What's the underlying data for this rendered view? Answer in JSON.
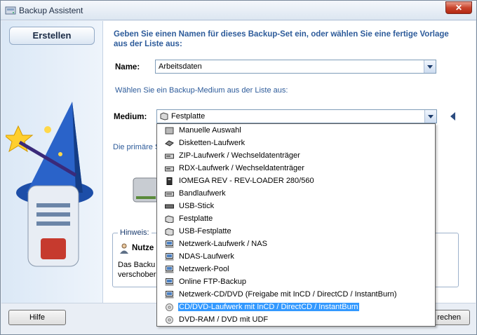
{
  "window": {
    "title": "Backup Assistent",
    "close_glyph": "✕"
  },
  "left": {
    "tab_label": "Erstellen"
  },
  "instruction": "Geben Sie einen Namen für dieses Backup-Set ein, oder wählen Sie eine fertige Vorlage aus der Liste aus:",
  "name_field": {
    "label": "Name:",
    "value": "Arbeitsdaten"
  },
  "medium_instruction": "Wählen Sie ein Backup-Medium aus der Liste aus:",
  "medium_field": {
    "label": "Medium:",
    "value": "Festplatte"
  },
  "partial_text": "Die primäre S",
  "hint": {
    "title": "Hinweis:",
    "head": "Nutze",
    "line1": "Das Backu",
    "line2": "verschober"
  },
  "buttons": {
    "help": "Hilfe",
    "cancel_partial": "rechen"
  },
  "medium_options": [
    {
      "label": "Manuelle Auswahl",
      "icon": "manual-icon"
    },
    {
      "label": "Disketten-Laufwerk",
      "icon": "floppy-icon"
    },
    {
      "label": "ZIP-Laufwerk / Wechseldatenträger",
      "icon": "zip-drive-icon"
    },
    {
      "label": "RDX-Laufwerk / Wechseldatenträger",
      "icon": "rdx-drive-icon"
    },
    {
      "label": "IOMEGA REV - REV-LOADER 280/560",
      "icon": "rev-drive-icon"
    },
    {
      "label": "Bandlaufwerk",
      "icon": "tape-drive-icon"
    },
    {
      "label": "USB-Stick",
      "icon": "usb-stick-icon"
    },
    {
      "label": "Festplatte",
      "icon": "hard-disk-icon"
    },
    {
      "label": "USB-Festplatte",
      "icon": "usb-hard-disk-icon"
    },
    {
      "label": "Netzwerk-Laufwerk / NAS",
      "icon": "network-drive-icon"
    },
    {
      "label": "NDAS-Laufwerk",
      "icon": "ndas-drive-icon"
    },
    {
      "label": "Netzwerk-Pool",
      "icon": "network-pool-icon"
    },
    {
      "label": "Online FTP-Backup",
      "icon": "ftp-icon"
    },
    {
      "label": "Netzwerk-CD/DVD (Freigabe mit InCD / DirectCD / InstantBurn)",
      "icon": "network-cd-icon"
    },
    {
      "label": "CD/DVD-Laufwerk mit InCD / DirectCD / InstantBurn",
      "icon": "cd-icon"
    },
    {
      "label": "DVD-RAM / DVD mit UDF",
      "icon": "dvd-icon"
    }
  ],
  "selected_option_index": 14,
  "colors": {
    "accent_text": "#2d5b9a",
    "selection": "#3399ff",
    "title_bar": "#dce6f1"
  }
}
